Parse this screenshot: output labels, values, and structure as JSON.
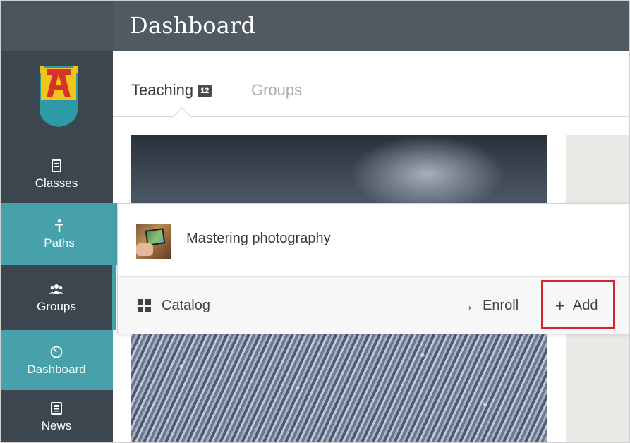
{
  "header": {
    "title": "Dashboard"
  },
  "sidebar": {
    "items": [
      {
        "label": "Classes",
        "icon": "book-icon"
      },
      {
        "label": "Paths",
        "icon": "signpost-icon"
      },
      {
        "label": "Groups",
        "icon": "people-icon"
      },
      {
        "label": "Dashboard",
        "icon": "gauge-icon"
      },
      {
        "label": "News",
        "icon": "newspaper-icon"
      }
    ]
  },
  "tabs": [
    {
      "label": "Teaching",
      "badge": "12"
    },
    {
      "label": "Groups"
    }
  ],
  "popup": {
    "course_title": "Mastering photography",
    "catalog_label": "Catalog",
    "enroll_label": "Enroll",
    "add_label": "Add"
  },
  "colors": {
    "header_bg": "#4f5a62",
    "sidebar_bg": "#3c464e",
    "accent_teal": "#47a1ab",
    "highlight_red": "#d7232a"
  }
}
